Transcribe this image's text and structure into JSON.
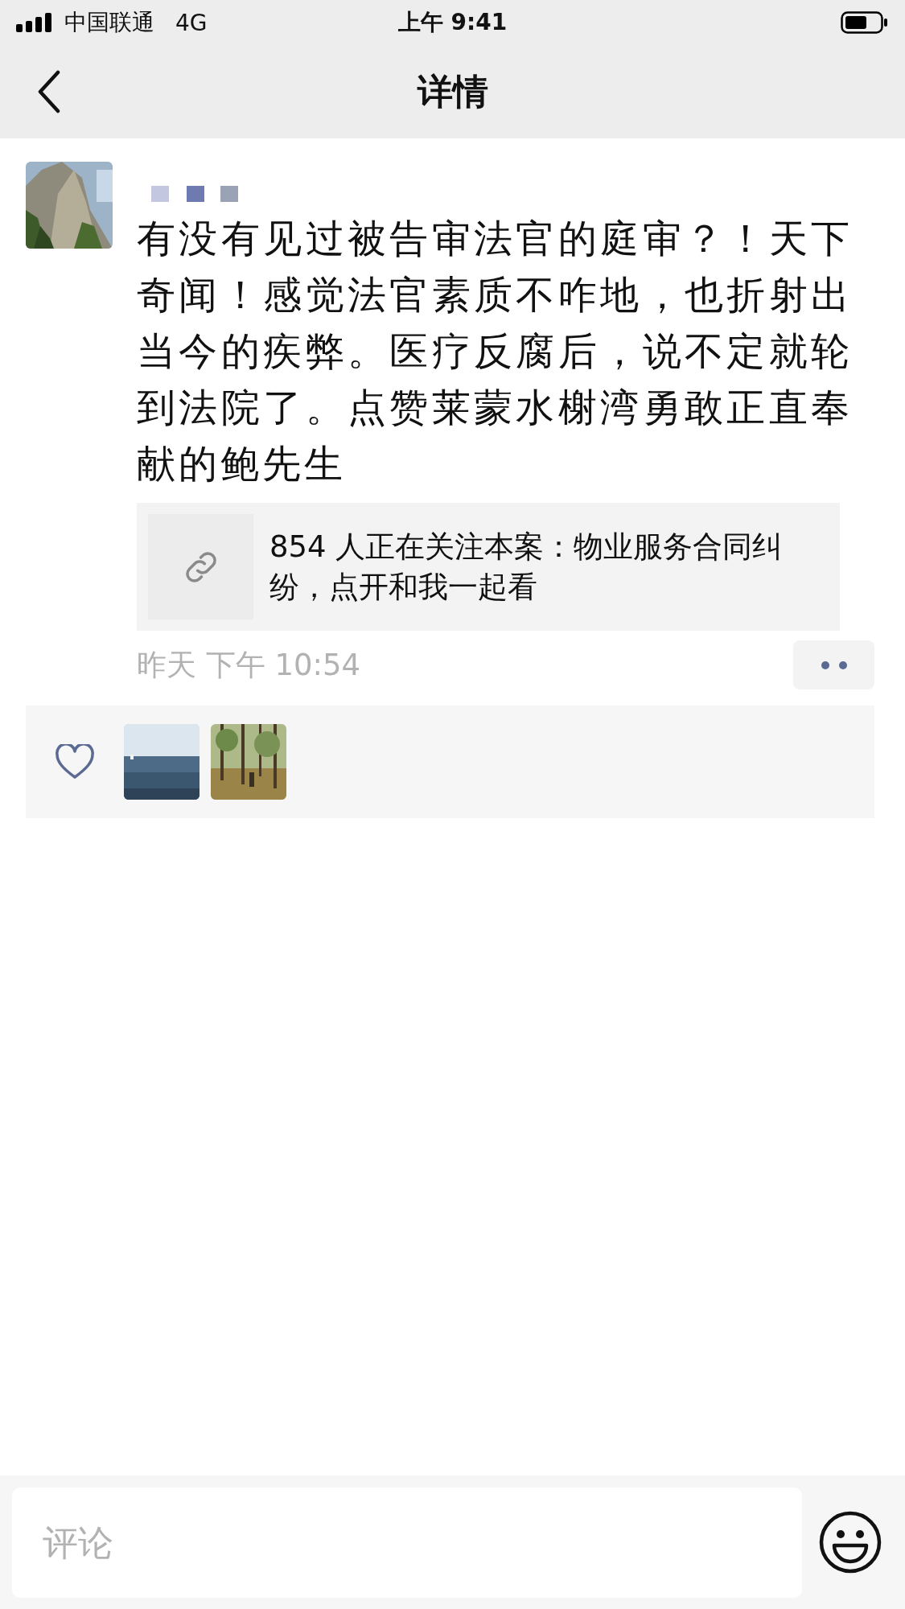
{
  "status_bar": {
    "carrier": "中国联通",
    "network": "4G",
    "time": "上午 9:41"
  },
  "nav_bar": {
    "title": "详情"
  },
  "post": {
    "text": "有没有见过被告审法官的庭审？！天下奇闻！感觉法官素质不咋地，也折射出当今的疾弊。医疗反腐后，说不定就轮到法院了。点赞莱蒙水榭湾勇敢正直奉献的鲍先生",
    "link": {
      "text": "854 人正在关注本案：物业服务合同纠纷，点开和我一起看"
    },
    "time": "昨天 下午 10:54"
  },
  "comment_bar": {
    "placeholder": "评论"
  }
}
